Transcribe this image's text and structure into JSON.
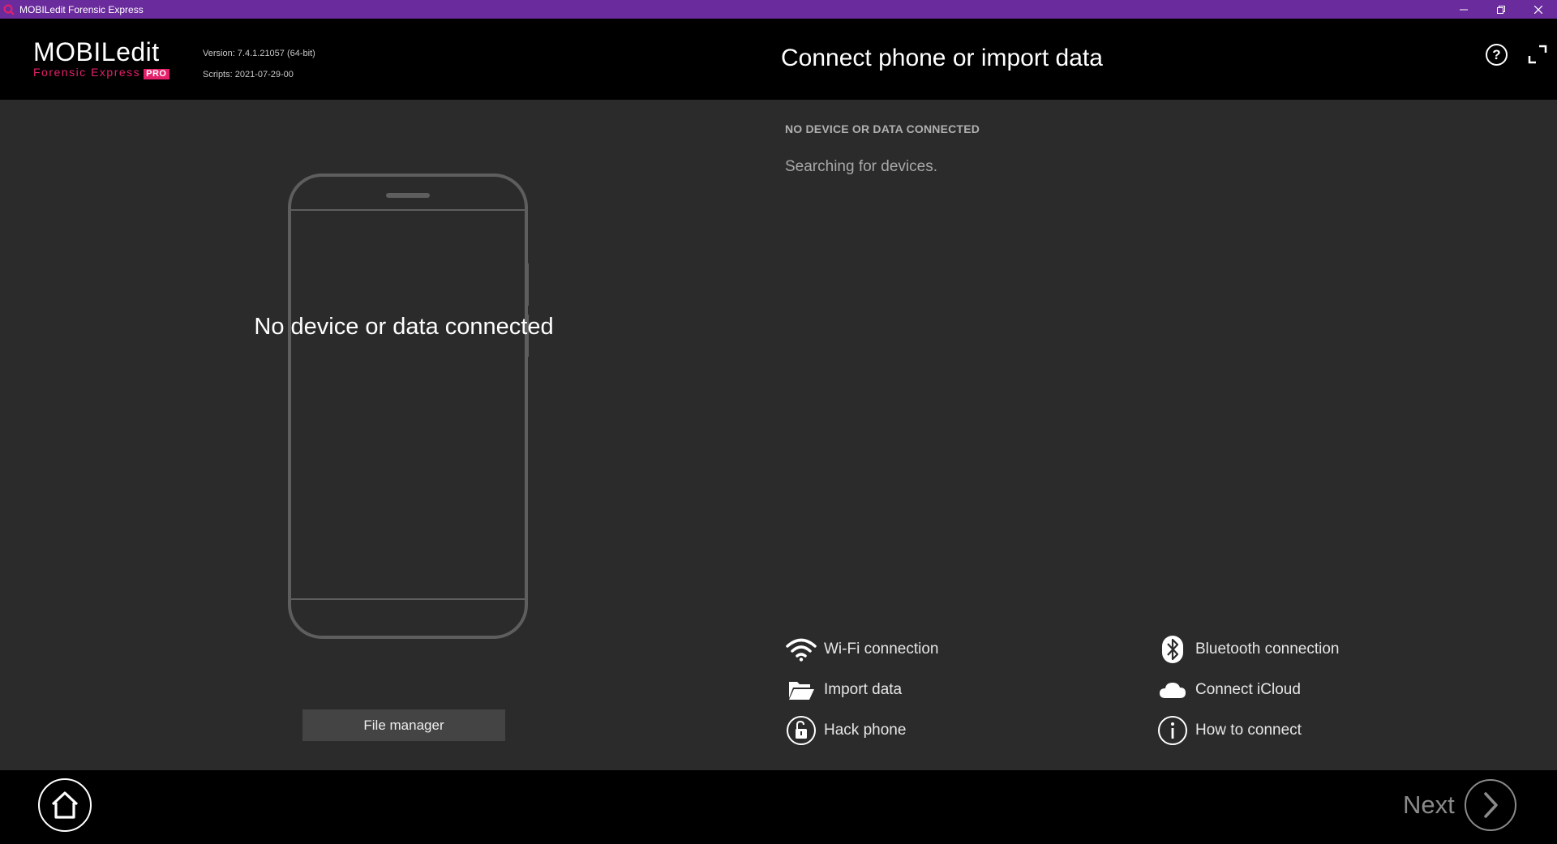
{
  "window": {
    "title": "MOBILedit Forensic Express",
    "controls": [
      "minimize",
      "restore",
      "close"
    ]
  },
  "header": {
    "brand": "MOBILedit",
    "brand_sub": "Forensic Express",
    "brand_badge": "PRO",
    "version": "Version: 7.4.1.21057 (64-bit)",
    "scripts": "Scripts: 2021-07-29-00",
    "title": "Connect phone or import data",
    "help_label": "?"
  },
  "phone_panel": {
    "message": "No device or data connected",
    "file_manager_label": "File manager"
  },
  "status": {
    "heading": "NO DEVICE OR DATA CONNECTED",
    "text": "Searching for devices."
  },
  "options": {
    "wifi": "Wi-Fi connection",
    "bluetooth": "Bluetooth connection",
    "import": "Import data",
    "icloud": "Connect iCloud",
    "hack": "Hack phone",
    "how_to": "How to connect"
  },
  "footer": {
    "next_label": "Next"
  },
  "colors": {
    "titlebar": "#6a2b9c",
    "accent": "#e5206a",
    "background": "#2b2b2b",
    "header": "#000000"
  }
}
